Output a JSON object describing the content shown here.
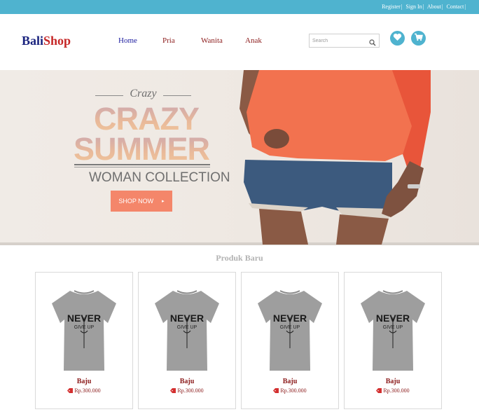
{
  "topbar": {
    "links": [
      "Register",
      "Sign In",
      "About",
      "Contact"
    ],
    "separator": "|",
    "bg_color": "#4fb3cf"
  },
  "header": {
    "logo_part1": "Bali",
    "logo_part2": "Shop",
    "nav": [
      "Home",
      "Pria",
      "Wanita",
      "Anak"
    ],
    "search_placeholder": "Search",
    "icons": [
      "search-icon",
      "heart-icon",
      "cart-icon"
    ]
  },
  "banner": {
    "script_word": "Crazy",
    "headline_line1": "CRAZY",
    "headline_line2": "SUMMER",
    "subheadline": "WOMAN COLLECTION",
    "cta": "SHOP NOW",
    "cta_arrow": "▸",
    "cta_color": "#f4866a"
  },
  "products": {
    "title": "Produk Baru",
    "shirt_text_line1": "NEVER",
    "shirt_text_line2": "GIVE UP",
    "items": [
      {
        "name": "Baju",
        "price": "Rp.300.000"
      },
      {
        "name": "Baju",
        "price": "Rp.300.000"
      },
      {
        "name": "Baju",
        "price": "Rp.300.000"
      },
      {
        "name": "Baju",
        "price": "Rp.300.000"
      }
    ]
  }
}
